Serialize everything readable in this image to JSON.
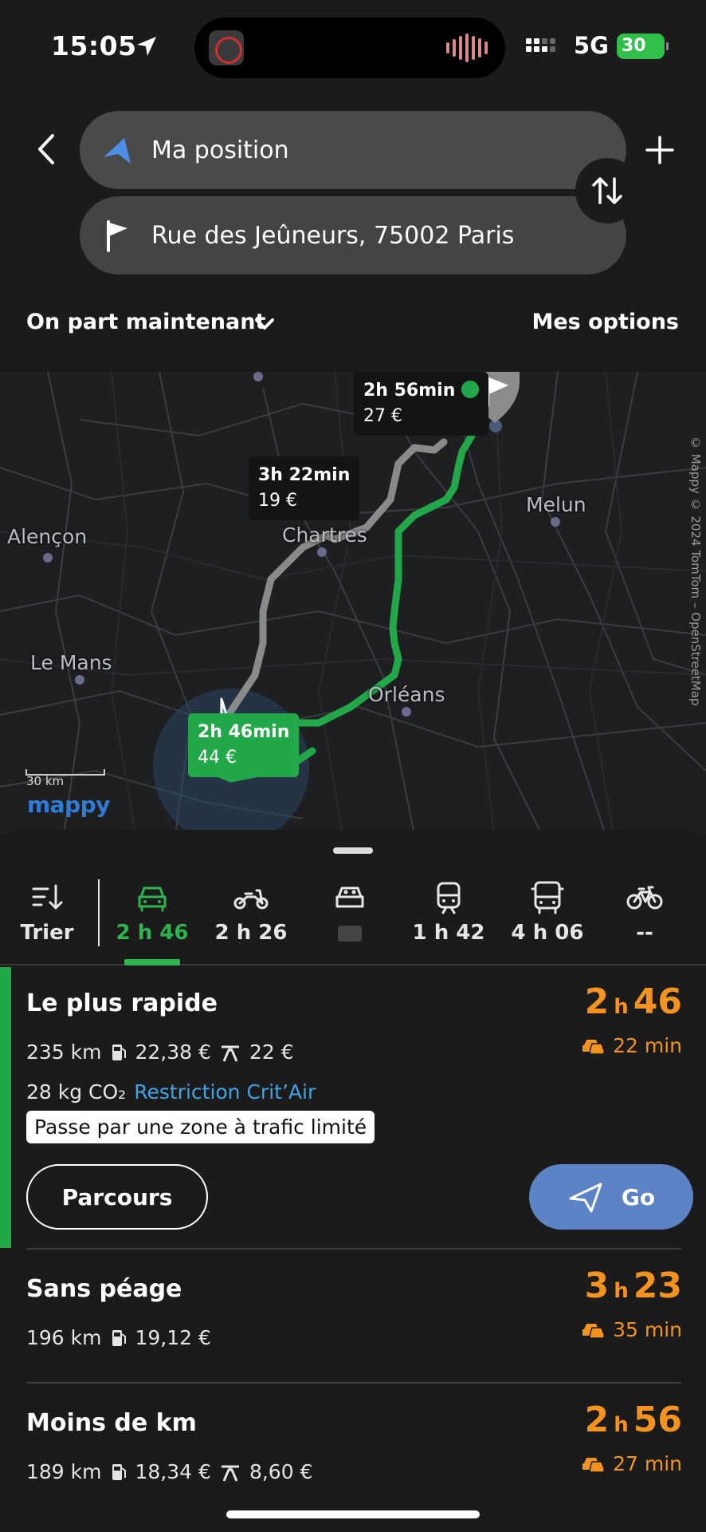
{
  "status_bar": {
    "time": "15:05",
    "network": "5G",
    "battery": "30"
  },
  "search": {
    "from": "Ma position",
    "to": "Rue des Jeûneurs, 75002 Paris"
  },
  "depart_label": "On part maintenant",
  "options_label": "Mes options",
  "map": {
    "cities": [
      "Alençon",
      "Chartres",
      "Melun",
      "Le Mans",
      "Orléans"
    ],
    "bubbles": [
      {
        "time": "2h 56min",
        "price": "27 €"
      },
      {
        "time": "3h 22min",
        "price": "19 €"
      },
      {
        "time": "2h 46min",
        "price": "44 €"
      }
    ],
    "scale": "30 km",
    "logo": "mappy",
    "copyright": "© Mappy © 2024 TomTom – OpenStreetMap"
  },
  "modes": {
    "sort_label": "Trier",
    "items": [
      {
        "icon": "car-icon",
        "label": "2 h 46"
      },
      {
        "icon": "motorbike-icon",
        "label": "2 h 26"
      },
      {
        "icon": "carpool-icon",
        "label": ""
      },
      {
        "icon": "train-icon",
        "label": "1 h 42"
      },
      {
        "icon": "bus-icon",
        "label": "4 h 06"
      },
      {
        "icon": "bike-icon",
        "label": "--"
      }
    ]
  },
  "routes": [
    {
      "title": "Le plus rapide",
      "hours": "2",
      "minutes": "46",
      "h_unit": "h",
      "delay": "22 min",
      "distance": "235 km",
      "fuel": "22,38 €",
      "toll": "22 €",
      "co2": "28 kg CO₂",
      "crit_air": "Restriction Crit’Air",
      "tag": "Passe par une zone à trafic limité",
      "parcours_label": "Parcours",
      "go_label": "Go"
    },
    {
      "title": "Sans péage",
      "hours": "3",
      "minutes": "23",
      "h_unit": "h",
      "delay": "35 min",
      "distance": "196 km",
      "fuel": "19,12 €"
    },
    {
      "title": "Moins de km",
      "hours": "2",
      "minutes": "56",
      "h_unit": "h",
      "delay": "27 min",
      "distance": "189 km",
      "fuel": "18,34 €",
      "toll": "8,60 €"
    }
  ],
  "colors": {
    "accent_green": "#22a849",
    "time_orange": "#f4931f",
    "go_blue": "#5b83c5",
    "link_blue": "#3fa5e8"
  }
}
